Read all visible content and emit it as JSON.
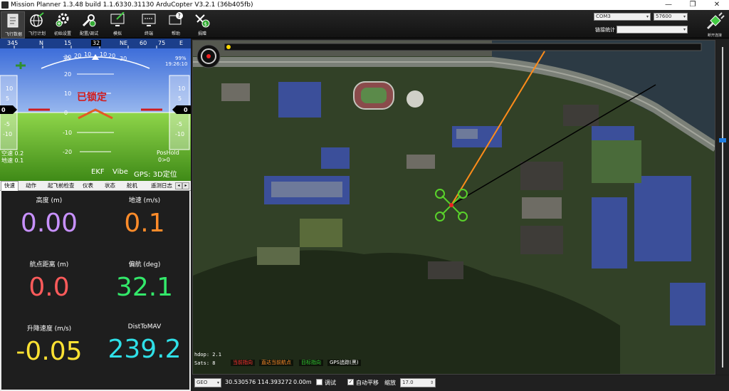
{
  "window": {
    "title": "Mission Planner 1.3.48 build 1.1.6330.31130 ArduCopter V3.2.1 (36b405fb)",
    "minimize": "—",
    "maximize": "❐",
    "close": "✕"
  },
  "toolbar": {
    "items": [
      {
        "label": "飞行数据",
        "icon": "flight-data-icon"
      },
      {
        "label": "飞行计划",
        "icon": "flight-plan-icon"
      },
      {
        "label": "初始设置",
        "icon": "initial-setup-icon"
      },
      {
        "label": "配置/调试",
        "icon": "config-tuning-icon"
      },
      {
        "label": "模拟",
        "icon": "simulation-icon"
      },
      {
        "label": "终端",
        "icon": "terminal-icon"
      },
      {
        "label": "帮助",
        "icon": "help-icon"
      },
      {
        "label": "捐赠",
        "icon": "donate-icon"
      }
    ],
    "port": "COM3",
    "baud": "57600",
    "link_stats_label": "链接统计",
    "connect_label": "断开连接"
  },
  "hud": {
    "compass": [
      "345",
      "N",
      "15",
      "30",
      "NE",
      "60",
      "75",
      "E"
    ],
    "heading": "32",
    "pitch_marks": [
      "30",
      "20",
      "10",
      "0",
      "-10",
      "-20"
    ],
    "roll_marks": [
      "30",
      "20",
      "10",
      "0",
      "10",
      "20",
      "30"
    ],
    "left_tape": [
      "10",
      "5",
      "0",
      "-5",
      "-10"
    ],
    "right_tape": [
      "10",
      "5",
      "0",
      "-5",
      "-10"
    ],
    "left_value": "0",
    "right_value": "0",
    "status": "已锁定",
    "battery": "99%",
    "clock": "19:26:10",
    "airspeed": "空速 0.2",
    "groundspeed": "地速 0.1",
    "mode": "PosHold",
    "mode_value": "0>0",
    "ekf": "EKF",
    "vibe": "Vibe",
    "gps": "GPS: 3D定位"
  },
  "tabs": {
    "items": [
      "快速",
      "动作",
      "起飞前检查",
      "仪表",
      "状态",
      "舵机",
      "遥测日志"
    ],
    "active": 0,
    "left_arrow": "◂",
    "right_arrow": "▸"
  },
  "quick": {
    "cells": [
      {
        "label": "高度 (m)",
        "value": "0.00",
        "color": "#c891ff"
      },
      {
        "label": "地速 (m/s)",
        "value": "0.1",
        "color": "#ff8c2a"
      },
      {
        "label": "航点距离 (m)",
        "value": "0.0",
        "color": "#ff5b5b"
      },
      {
        "label": "偏航 (deg)",
        "value": "32.1",
        "color": "#33e86a"
      },
      {
        "label": "升降速度 (m/s)",
        "value": "-0.05",
        "color": "#ffe233"
      },
      {
        "label": "DistToMAV",
        "value": "239.2",
        "color": "#2fe0e8"
      }
    ]
  },
  "map": {
    "hdop": "hdop: 2.1",
    "sats": "Sats: 8",
    "legend": [
      {
        "label": "当前指向",
        "color": "#ff3333"
      },
      {
        "label": "直达当前航点",
        "color": "#ff8c2a"
      },
      {
        "label": "目标指向",
        "color": "#33cc33"
      },
      {
        "label": "GPS追踪(黑)",
        "color": "#ffffff"
      }
    ]
  },
  "bottombar": {
    "coord_system": "GEO",
    "coords": "30.530576 114.393272",
    "alt": "0.00m",
    "debug_label": "调试",
    "autopan_label": "自动平移",
    "zoom_label": "缩放",
    "zoom_value": "17.0"
  }
}
